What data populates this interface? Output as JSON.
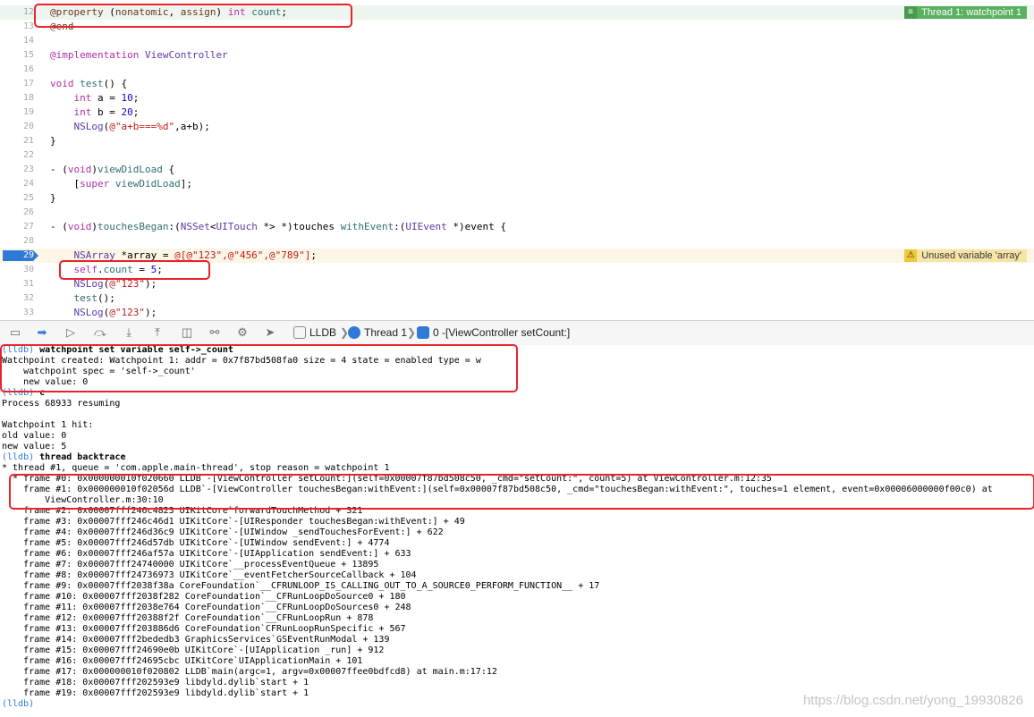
{
  "editor": {
    "lines": [
      {
        "n": "12",
        "segs": [
          [
            "pp",
            "@property"
          ],
          [
            "plain",
            " ("
          ],
          [
            "pp",
            "nonatomic"
          ],
          [
            "plain",
            ", "
          ],
          [
            "pp",
            "assign"
          ],
          [
            "plain",
            ") "
          ],
          [
            "kw",
            "int"
          ],
          [
            "plain",
            " "
          ],
          [
            "fn",
            "count"
          ],
          [
            "plain",
            ";"
          ]
        ],
        "hl": "green",
        "badge": {
          "type": "green",
          "icon": "≡",
          "text": "Thread 1: watchpoint 1"
        }
      },
      {
        "n": "13",
        "segs": [
          [
            "pp",
            "@end"
          ]
        ]
      },
      {
        "n": "14",
        "segs": []
      },
      {
        "n": "15",
        "segs": [
          [
            "kw",
            "@implementation"
          ],
          [
            "plain",
            " "
          ],
          [
            "ty",
            "ViewController"
          ]
        ]
      },
      {
        "n": "16",
        "segs": []
      },
      {
        "n": "17",
        "segs": [
          [
            "kw",
            "void"
          ],
          [
            "plain",
            " "
          ],
          [
            "fn",
            "test"
          ],
          [
            "plain",
            "() {"
          ]
        ]
      },
      {
        "n": "18",
        "segs": [
          [
            "plain",
            "    "
          ],
          [
            "kw",
            "int"
          ],
          [
            "plain",
            " a = "
          ],
          [
            "num",
            "10"
          ],
          [
            "plain",
            ";"
          ]
        ]
      },
      {
        "n": "19",
        "segs": [
          [
            "plain",
            "    "
          ],
          [
            "kw",
            "int"
          ],
          [
            "plain",
            " b = "
          ],
          [
            "num",
            "20"
          ],
          [
            "plain",
            ";"
          ]
        ]
      },
      {
        "n": "20",
        "segs": [
          [
            "plain",
            "    "
          ],
          [
            "ty",
            "NSLog"
          ],
          [
            "plain",
            "("
          ],
          [
            "str",
            "@\"a+b===%d\""
          ],
          [
            "plain",
            ",a+b);"
          ]
        ]
      },
      {
        "n": "21",
        "segs": [
          [
            "plain",
            "}"
          ]
        ]
      },
      {
        "n": "22",
        "segs": []
      },
      {
        "n": "23",
        "segs": [
          [
            "plain",
            "- ("
          ],
          [
            "kw",
            "void"
          ],
          [
            "plain",
            ")"
          ],
          [
            "fn",
            "viewDidLoad"
          ],
          [
            "plain",
            " {"
          ]
        ]
      },
      {
        "n": "24",
        "segs": [
          [
            "plain",
            "    ["
          ],
          [
            "kw",
            "super"
          ],
          [
            "plain",
            " "
          ],
          [
            "fn",
            "viewDidLoad"
          ],
          [
            "plain",
            "];"
          ]
        ]
      },
      {
        "n": "25",
        "segs": [
          [
            "plain",
            "}"
          ]
        ]
      },
      {
        "n": "26",
        "segs": []
      },
      {
        "n": "27",
        "segs": [
          [
            "plain",
            "- ("
          ],
          [
            "kw",
            "void"
          ],
          [
            "plain",
            ")"
          ],
          [
            "fn",
            "touchesBegan"
          ],
          [
            "plain",
            ":("
          ],
          [
            "ty",
            "NSSet"
          ],
          [
            "plain",
            "<"
          ],
          [
            "ty",
            "UITouch"
          ],
          [
            "plain",
            " *> *)touches "
          ],
          [
            "fn",
            "withEvent"
          ],
          [
            "plain",
            ":("
          ],
          [
            "ty",
            "UIEvent"
          ],
          [
            "plain",
            " *)event {"
          ]
        ]
      },
      {
        "n": "28",
        "segs": []
      },
      {
        "n": "29",
        "segs": [
          [
            "plain",
            "    "
          ],
          [
            "ty",
            "NSArray"
          ],
          [
            "plain",
            " *array = "
          ],
          [
            "str",
            "@[@\"123\",@\"456\",@\"789\"]"
          ],
          [
            "plain",
            ";"
          ]
        ],
        "hl": "amber",
        "current": true,
        "badge": {
          "type": "amber",
          "icon": "⚠",
          "text": "Unused variable 'array'"
        }
      },
      {
        "n": "30",
        "segs": [
          [
            "plain",
            "    "
          ],
          [
            "kw",
            "self"
          ],
          [
            "plain",
            "."
          ],
          [
            "fn",
            "count"
          ],
          [
            "plain",
            " = "
          ],
          [
            "num",
            "5"
          ],
          [
            "plain",
            ";"
          ]
        ]
      },
      {
        "n": "31",
        "segs": [
          [
            "plain",
            "    "
          ],
          [
            "ty",
            "NSLog"
          ],
          [
            "plain",
            "("
          ],
          [
            "str",
            "@\"123\""
          ],
          [
            "plain",
            ");"
          ]
        ]
      },
      {
        "n": "32",
        "segs": [
          [
            "plain",
            "    "
          ],
          [
            "fn",
            "test"
          ],
          [
            "plain",
            "();"
          ]
        ]
      },
      {
        "n": "33",
        "segs": [
          [
            "plain",
            "    "
          ],
          [
            "ty",
            "NSLog"
          ],
          [
            "plain",
            "("
          ],
          [
            "str",
            "@\"123\""
          ],
          [
            "plain",
            ");"
          ]
        ]
      }
    ]
  },
  "debug_bar": {
    "buttons": [
      {
        "name": "hide-debug-area-button",
        "glyph": "▭"
      },
      {
        "name": "breakpoints-toggle-button",
        "glyph": "➡",
        "active": true
      },
      {
        "name": "continue-button",
        "glyph": "▷"
      },
      {
        "name": "step-over-button",
        "glyph": "⤼"
      },
      {
        "name": "step-into-button",
        "glyph": "⤓"
      },
      {
        "name": "step-out-button",
        "glyph": "⤒"
      },
      {
        "name": "view-hierarchy-button",
        "glyph": "◫"
      },
      {
        "name": "memory-graph-button",
        "glyph": "⚯"
      },
      {
        "name": "environment-overrides-button",
        "glyph": "⚙"
      },
      {
        "name": "simulate-location-button",
        "glyph": "➤"
      }
    ],
    "breadcrumb": {
      "lldb": "LLDB",
      "thread": "Thread 1",
      "frame": "0 -[ViewController setCount:]"
    }
  },
  "console": {
    "lines": [
      {
        "p": "(lldb) ",
        "c": "watchpoint set variable self->_count"
      },
      {
        "t": "Watchpoint created: Watchpoint 1: addr = 0x7f87bd508fa0 size = 4 state = enabled type = w"
      },
      {
        "t": "    watchpoint spec = 'self->_count'"
      },
      {
        "t": "    new value: 0"
      },
      {
        "p": "(lldb) ",
        "c": "c"
      },
      {
        "t": "Process 68933 resuming"
      },
      {
        "t": ""
      },
      {
        "t": "Watchpoint 1 hit:"
      },
      {
        "t": "old value: 0"
      },
      {
        "t": "new value: 5"
      },
      {
        "p": "(lldb) ",
        "c": "thread backtrace"
      },
      {
        "t": "* thread #1, queue = 'com.apple.main-thread', stop reason = watchpoint 1"
      },
      {
        "t": "  * frame #0: 0x000000010f020660 LLDB`-[ViewController setCount:](self=0x00007f87bd508c50, _cmd=\"setCount:\", count=5) at ViewController.m:12:35"
      },
      {
        "t": "    frame #1: 0x000000010f02056d LLDB`-[ViewController touchesBegan:withEvent:](self=0x00007f87bd508c50, _cmd=\"touchesBegan:withEvent:\", touches=1 element, event=0x00006000000f00c0) at"
      },
      {
        "t": "        ViewController.m:30:10"
      },
      {
        "t": "    frame #2: 0x00007fff246c4823 UIKitCore`forwardTouchMethod + 321"
      },
      {
        "t": "    frame #3: 0x00007fff246c46d1 UIKitCore`-[UIResponder touchesBegan:withEvent:] + 49"
      },
      {
        "t": "    frame #4: 0x00007fff246d36c9 UIKitCore`-[UIWindow _sendTouchesForEvent:] + 622"
      },
      {
        "t": "    frame #5: 0x00007fff246d57db UIKitCore`-[UIWindow sendEvent:] + 4774"
      },
      {
        "t": "    frame #6: 0x00007fff246af57a UIKitCore`-[UIApplication sendEvent:] + 633"
      },
      {
        "t": "    frame #7: 0x00007fff24740000 UIKitCore`__processEventQueue + 13895"
      },
      {
        "t": "    frame #8: 0x00007fff24736973 UIKitCore`__eventFetcherSourceCallback + 104"
      },
      {
        "t": "    frame #9: 0x00007fff2038f38a CoreFoundation`__CFRUNLOOP_IS_CALLING_OUT_TO_A_SOURCE0_PERFORM_FUNCTION__ + 17"
      },
      {
        "t": "    frame #10: 0x00007fff2038f282 CoreFoundation`__CFRunLoopDoSource0 + 180"
      },
      {
        "t": "    frame #11: 0x00007fff2038e764 CoreFoundation`__CFRunLoopDoSources0 + 248"
      },
      {
        "t": "    frame #12: 0x00007fff20388f2f CoreFoundation`__CFRunLoopRun + 878"
      },
      {
        "t": "    frame #13: 0x00007fff203886d6 CoreFoundation`CFRunLoopRunSpecific + 567"
      },
      {
        "t": "    frame #14: 0x00007fff2bededb3 GraphicsServices`GSEventRunModal + 139"
      },
      {
        "t": "    frame #15: 0x00007fff24690e0b UIKitCore`-[UIApplication _run] + 912"
      },
      {
        "t": "    frame #16: 0x00007fff24695cbc UIKitCore`UIApplicationMain + 101"
      },
      {
        "t": "    frame #17: 0x000000010f020802 LLDB`main(argc=1, argv=0x00007ffee0bdfcd8) at main.m:17:12"
      },
      {
        "t": "    frame #18: 0x00007fff202593e9 libdyld.dylib`start + 1"
      },
      {
        "t": "    frame #19: 0x00007fff202593e9 libdyld.dylib`start + 1"
      },
      {
        "p": "(lldb)",
        "c": ""
      }
    ]
  },
  "watermark": "https://blog.csdn.net/yong_19930826"
}
